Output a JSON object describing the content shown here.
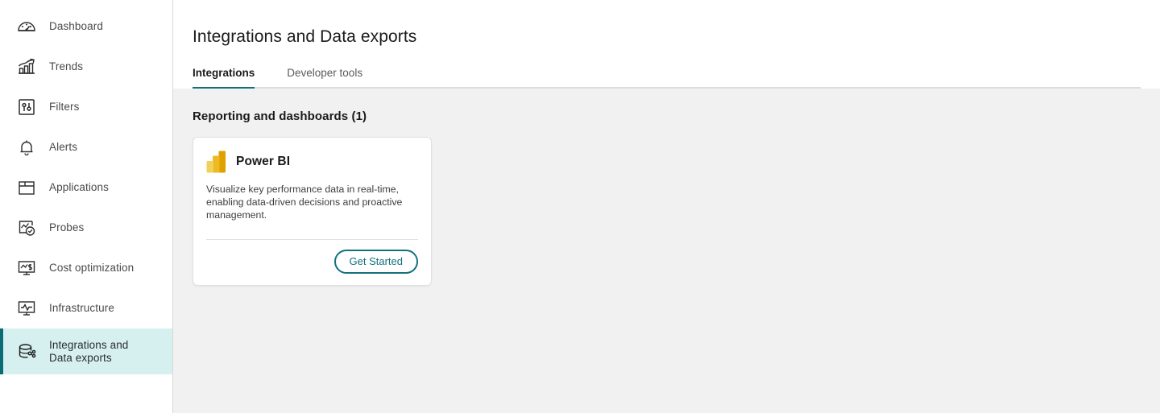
{
  "sidebar": {
    "items": [
      {
        "label": "Dashboard",
        "icon": "gauge-icon",
        "active": false
      },
      {
        "label": "Trends",
        "icon": "bar-chart-arrow-icon",
        "active": false
      },
      {
        "label": "Filters",
        "icon": "sliders-icon",
        "active": false
      },
      {
        "label": "Alerts",
        "icon": "bell-icon",
        "active": false
      },
      {
        "label": "Applications",
        "icon": "browser-window-icon",
        "active": false
      },
      {
        "label": "Probes",
        "icon": "chart-check-icon",
        "active": false
      },
      {
        "label": "Cost optimization",
        "icon": "monitor-dollar-icon",
        "active": false
      },
      {
        "label": "Infrastructure",
        "icon": "monitor-pulse-icon",
        "active": false
      },
      {
        "label": "Integrations and Data exports",
        "icon": "database-share-icon",
        "active": true
      }
    ]
  },
  "header": {
    "title": "Integrations and Data exports"
  },
  "tabs": [
    {
      "label": "Integrations",
      "active": true
    },
    {
      "label": "Developer tools",
      "active": false
    }
  ],
  "main": {
    "section_title": "Reporting and dashboards (1)",
    "cards": [
      {
        "name": "Power BI",
        "logo": "power-bi-icon",
        "description": "Visualize key performance data in real-time, enabling data-driven decisions and proactive management.",
        "button_label": "Get Started"
      }
    ]
  },
  "colors": {
    "accent_teal": "#12717c",
    "active_nav_bg": "#d6f0f0",
    "active_nav_bar": "#0b6d73",
    "content_bg": "#f1f1f1",
    "card_bg": "#ffffff",
    "powerbi_light": "#f2d15a",
    "powerbi_mid": "#eeba22",
    "powerbi_dark": "#e0a000"
  }
}
